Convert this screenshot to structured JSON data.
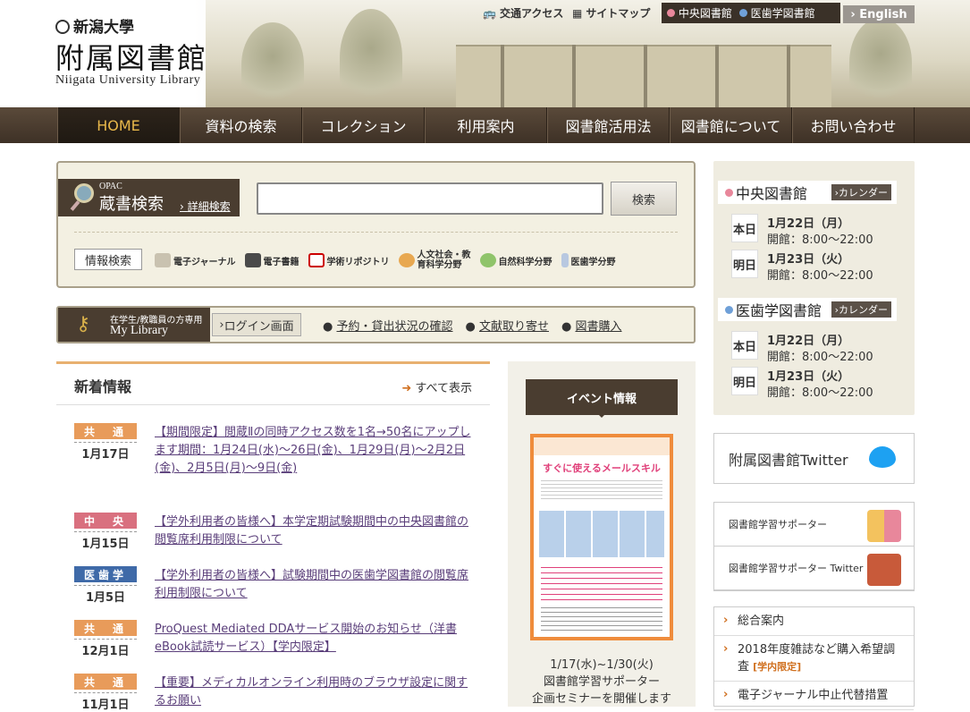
{
  "header": {
    "univ_name": "新潟大學",
    "library_name": "附属図書館",
    "library_name_en": "Niigata University Library",
    "util_links": [
      {
        "label": "交通アクセス",
        "icon": "bus-icon"
      },
      {
        "label": "サイトマップ",
        "icon": "sitemap-icon"
      }
    ],
    "library_buttons": [
      {
        "label": "中央図書館",
        "color": "#e8879b"
      },
      {
        "label": "医歯学図書館",
        "color": "#6fa0d8"
      }
    ],
    "english_button": "English"
  },
  "nav": {
    "items": [
      "HOME",
      "資料の検索",
      "コレクション",
      "利用案内",
      "図書館活用法",
      "図書館について",
      "お問い合わせ"
    ],
    "active_color": "#e8b84a"
  },
  "opac": {
    "label_small": "OPAC",
    "label_big": "蔵書検索",
    "advanced_link": "詳細検索",
    "input_value": "",
    "search_button": "検索",
    "info_label": "情報検索",
    "info_links": [
      {
        "label": "電子ジャーナル",
        "icon": "ejournal-icon"
      },
      {
        "label": "電子書籍",
        "icon": "ebook-icon"
      },
      {
        "label": "学術リポジトリ",
        "icon": "repository-icon"
      },
      {
        "label": "人文社会・教育科学分野",
        "icon": "humanities-icon"
      },
      {
        "label": "自然科学分野",
        "icon": "natural-science-icon"
      },
      {
        "label": "医歯学分野",
        "icon": "medical-icon"
      }
    ]
  },
  "mylibrary": {
    "small": "在学生/教職員の方専用",
    "title": "My Library",
    "login": "ログイン画面",
    "links": [
      "予約・貸出状況の確認",
      "文献取り寄せ",
      "図書購入"
    ]
  },
  "news": {
    "title": "新着情報",
    "show_all": "すべて表示",
    "items": [
      {
        "badge": "共　通",
        "badge_color": "#e89b5a",
        "date": "1月17日",
        "text": "【期間限定】閲蔵Ⅱの同時アクセス数を1名→50名にアップします期間：1月24日(水)～26日(金)、1月29日(月)～2月2日(金)、2月5日(月)～9日(金)"
      },
      {
        "badge": "中　央",
        "badge_color": "#d9707f",
        "date": "1月15日",
        "text": "【学外利用者の皆様へ】本学定期試験期間中の中央図書館の閲覧席利用制限について"
      },
      {
        "badge": "医歯学",
        "badge_color": "#3f6aa8",
        "date": "1月5日",
        "text": "【学外利用者の皆様へ】試験期間中の医歯学図書館の閲覧席利用制限について"
      },
      {
        "badge": "共　通",
        "badge_color": "#e89b5a",
        "date": "12月1日",
        "text": "ProQuest Mediated DDAサービス開始のお知らせ（洋書eBook試読サービス）【学内限定】"
      },
      {
        "badge": "共　通",
        "badge_color": "#e89b5a",
        "date": "11月1日",
        "text": "【重要】メディカルオンライン利用時のブラウザ設定に関するお願い"
      }
    ]
  },
  "event": {
    "title": "イベント情報",
    "poster_heading": "すぐに使えるメールスキル",
    "caption_line1": "1/17(水)~1/30(火)",
    "caption_line2": "図書館学習サポーター",
    "caption_line3": "企画セミナーを開催します"
  },
  "libraries": [
    {
      "name": "中央図書館",
      "color": "#e8879b",
      "calendar": "カレンダー",
      "days": [
        {
          "label": "本日",
          "date": "1月22日（月）",
          "hours": "開館：8:00～22:00"
        },
        {
          "label": "明日",
          "date": "1月23日（火）",
          "hours": "開館：8:00～22:00"
        }
      ]
    },
    {
      "name": "医歯学図書館",
      "color": "#6fa0d8",
      "calendar": "カレンダー",
      "days": [
        {
          "label": "本日",
          "date": "1月22日（月）",
          "hours": "開館：8:00～22:00"
        },
        {
          "label": "明日",
          "date": "1月23日（火）",
          "hours": "開館：8:00～22:00"
        }
      ]
    }
  ],
  "twitter": {
    "label": "附属図書館Twitter",
    "icon": "twitter-bird-icon"
  },
  "support": [
    {
      "label": "図書館学習サポーター",
      "icon": "supporters-icon"
    },
    {
      "label": "図書館学習サポーター Twitter",
      "icon": "supporter-twitter-icon"
    }
  ],
  "guide": [
    {
      "label": "総合案内",
      "tag": ""
    },
    {
      "label": "2018年度雑誌など購入希望調査",
      "tag": "[学内限定]"
    },
    {
      "label": "電子ジャーナル中止代替措置",
      "tag": ""
    }
  ]
}
